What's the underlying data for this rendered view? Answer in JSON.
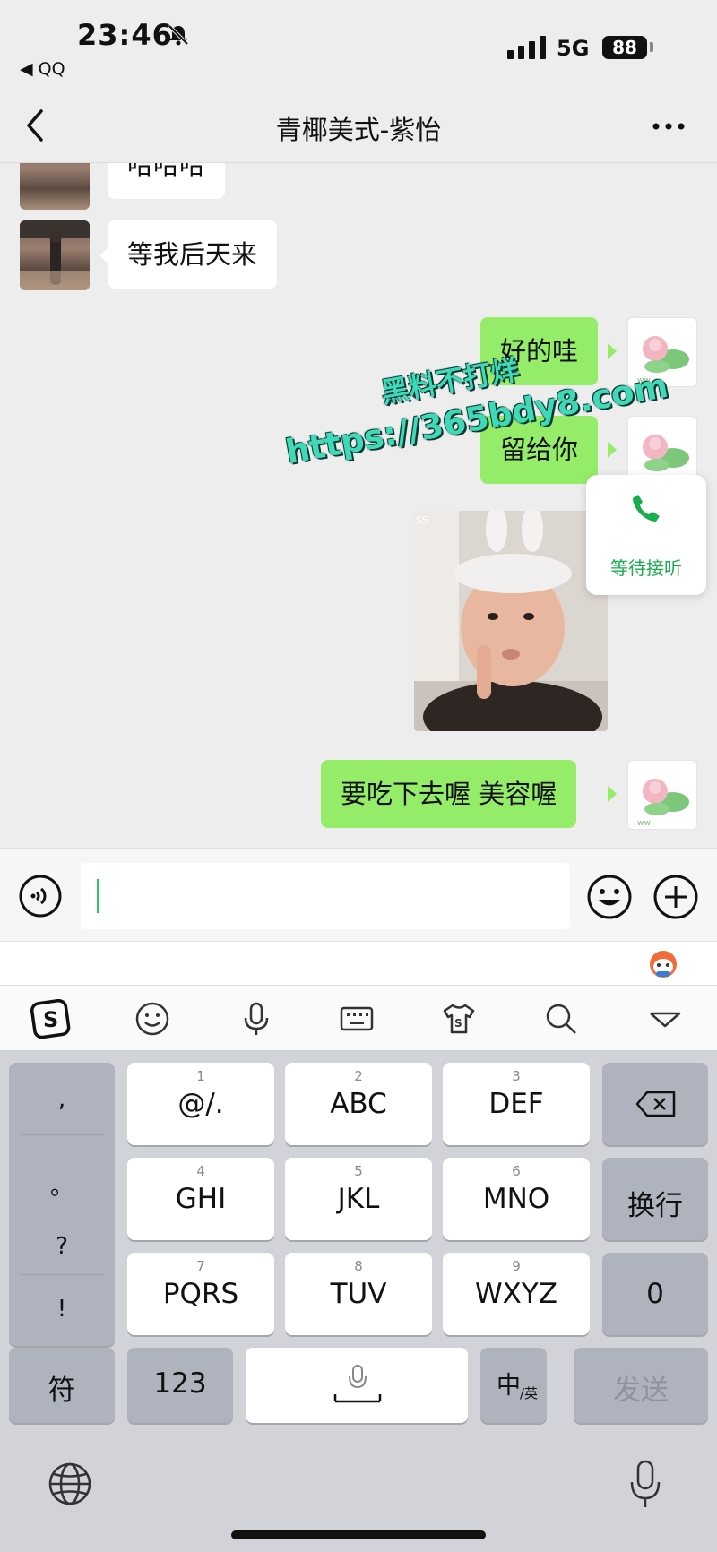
{
  "status_bar": {
    "time": "23:46",
    "back_app": "◀ QQ",
    "network": "5G",
    "battery": "88"
  },
  "nav": {
    "title": "青椰美式-紫怡"
  },
  "chat": {
    "partial_message": "哈哈哈",
    "messages": [
      {
        "side": "in",
        "text": "等我后天来"
      },
      {
        "side": "out",
        "text": "好的哇"
      },
      {
        "side": "out",
        "text": "留给你"
      },
      {
        "side": "out",
        "text": "要吃下去喔  美容喔"
      }
    ],
    "watermark_line1": "黑料不打烊",
    "watermark_line2": "https://365bdy8.com",
    "call_status": "等待接听"
  },
  "keyboard": {
    "keys": [
      {
        "num": "1",
        "label": "@/."
      },
      {
        "num": "2",
        "label": "ABC"
      },
      {
        "num": "3",
        "label": "DEF"
      },
      {
        "num": "4",
        "label": "GHI"
      },
      {
        "num": "5",
        "label": "JKL"
      },
      {
        "num": "6",
        "label": "MNO"
      },
      {
        "num": "7",
        "label": "PQRS"
      },
      {
        "num": "8",
        "label": "TUV"
      },
      {
        "num": "9",
        "label": "WXYZ"
      }
    ],
    "side_punct": [
      ",",
      "。",
      "?",
      "!"
    ],
    "newline": "换行",
    "zero": "0",
    "symbols": "符",
    "numbers": "123",
    "lang_main": "中",
    "lang_sub": "/英",
    "send": "发送"
  },
  "colors": {
    "bubble_out": "#95ec69",
    "call_green": "#1aad4e",
    "watermark": "#3fd9b8"
  }
}
